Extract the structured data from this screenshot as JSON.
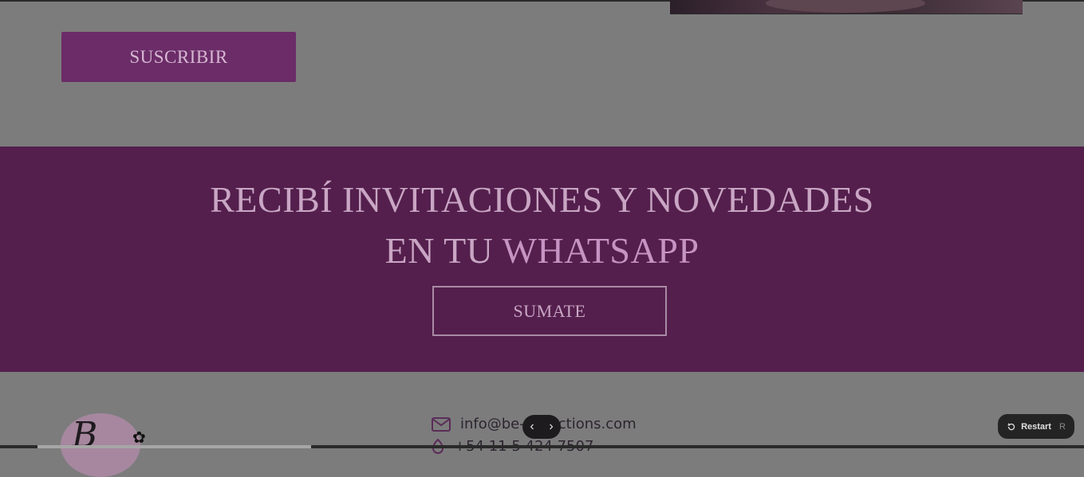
{
  "subscribe": {
    "label": "SUSCRIBIR"
  },
  "whatsapp_band": {
    "line1": "RECIBÍ INVITACIONES Y NOVEDADES",
    "line2_prefix": "EN TU ",
    "line2_accent": "WHATSAPP",
    "button_label": "SUMATE"
  },
  "footer": {
    "logo_letter": "B",
    "email": "info@be-collections.com",
    "phone": "+54 11 5 424 7507"
  },
  "carousel": {
    "prev_icon": "chevron-left-icon",
    "next_icon": "chevron-right-icon",
    "prev": "‹",
    "next": "›"
  },
  "restart": {
    "label": "Restart",
    "shortcut": "R",
    "icon": "restart-icon"
  },
  "colors": {
    "brand_purple": "#6b2c68",
    "band_purple": "#541f4d",
    "overlay_gray": "#7c7c7c"
  }
}
